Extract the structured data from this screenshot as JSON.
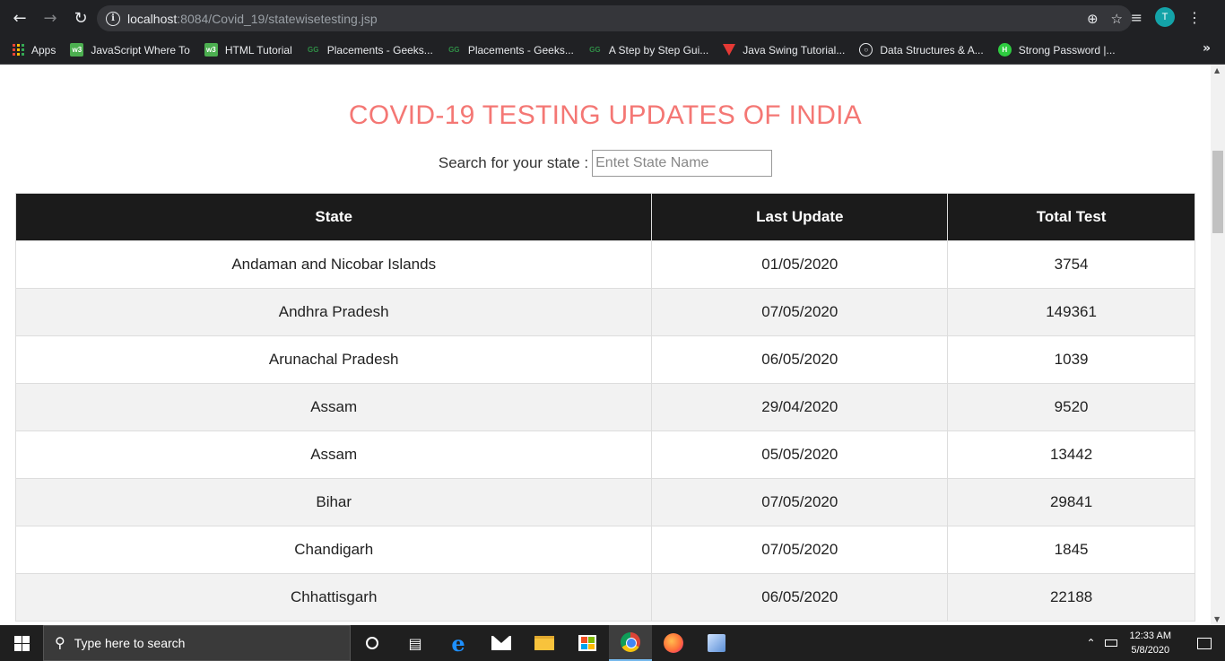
{
  "browser": {
    "url_host": "localhost",
    "url_path": ":8084/Covid_19/statewisetesting.jsp",
    "profile_initial": "T",
    "bookmarks": [
      {
        "label": "Apps"
      },
      {
        "label": "JavaScript Where To"
      },
      {
        "label": "HTML Tutorial"
      },
      {
        "label": "Placements - Geeks..."
      },
      {
        "label": "Placements - Geeks..."
      },
      {
        "label": "A Step by Step Gui..."
      },
      {
        "label": "Java Swing Tutorial..."
      },
      {
        "label": "Data Structures & A..."
      },
      {
        "label": "Strong Password |..."
      }
    ]
  },
  "page": {
    "title": "COVID-19 TESTING UPDATES OF INDIA",
    "search_label": "Search for your state :",
    "search_placeholder": "Entet State Name",
    "table": {
      "headers": [
        "State",
        "Last Update",
        "Total Test"
      ],
      "rows": [
        [
          "Andaman and Nicobar Islands",
          "01/05/2020",
          "3754"
        ],
        [
          "Andhra Pradesh",
          "07/05/2020",
          "149361"
        ],
        [
          "Arunachal Pradesh",
          "06/05/2020",
          "1039"
        ],
        [
          "Assam",
          "29/04/2020",
          "9520"
        ],
        [
          "Assam",
          "05/05/2020",
          "13442"
        ],
        [
          "Bihar",
          "07/05/2020",
          "29841"
        ],
        [
          "Chandigarh",
          "07/05/2020",
          "1845"
        ],
        [
          "Chhattisgarh",
          "06/05/2020",
          "22188"
        ]
      ]
    }
  },
  "taskbar": {
    "search_placeholder": "Type here to search",
    "time": "12:33 AM",
    "date": "5/8/2020"
  },
  "colors": {
    "title": "#f47774",
    "header_bg": "#1b1b1b",
    "row_alt": "#f2f2f2"
  }
}
